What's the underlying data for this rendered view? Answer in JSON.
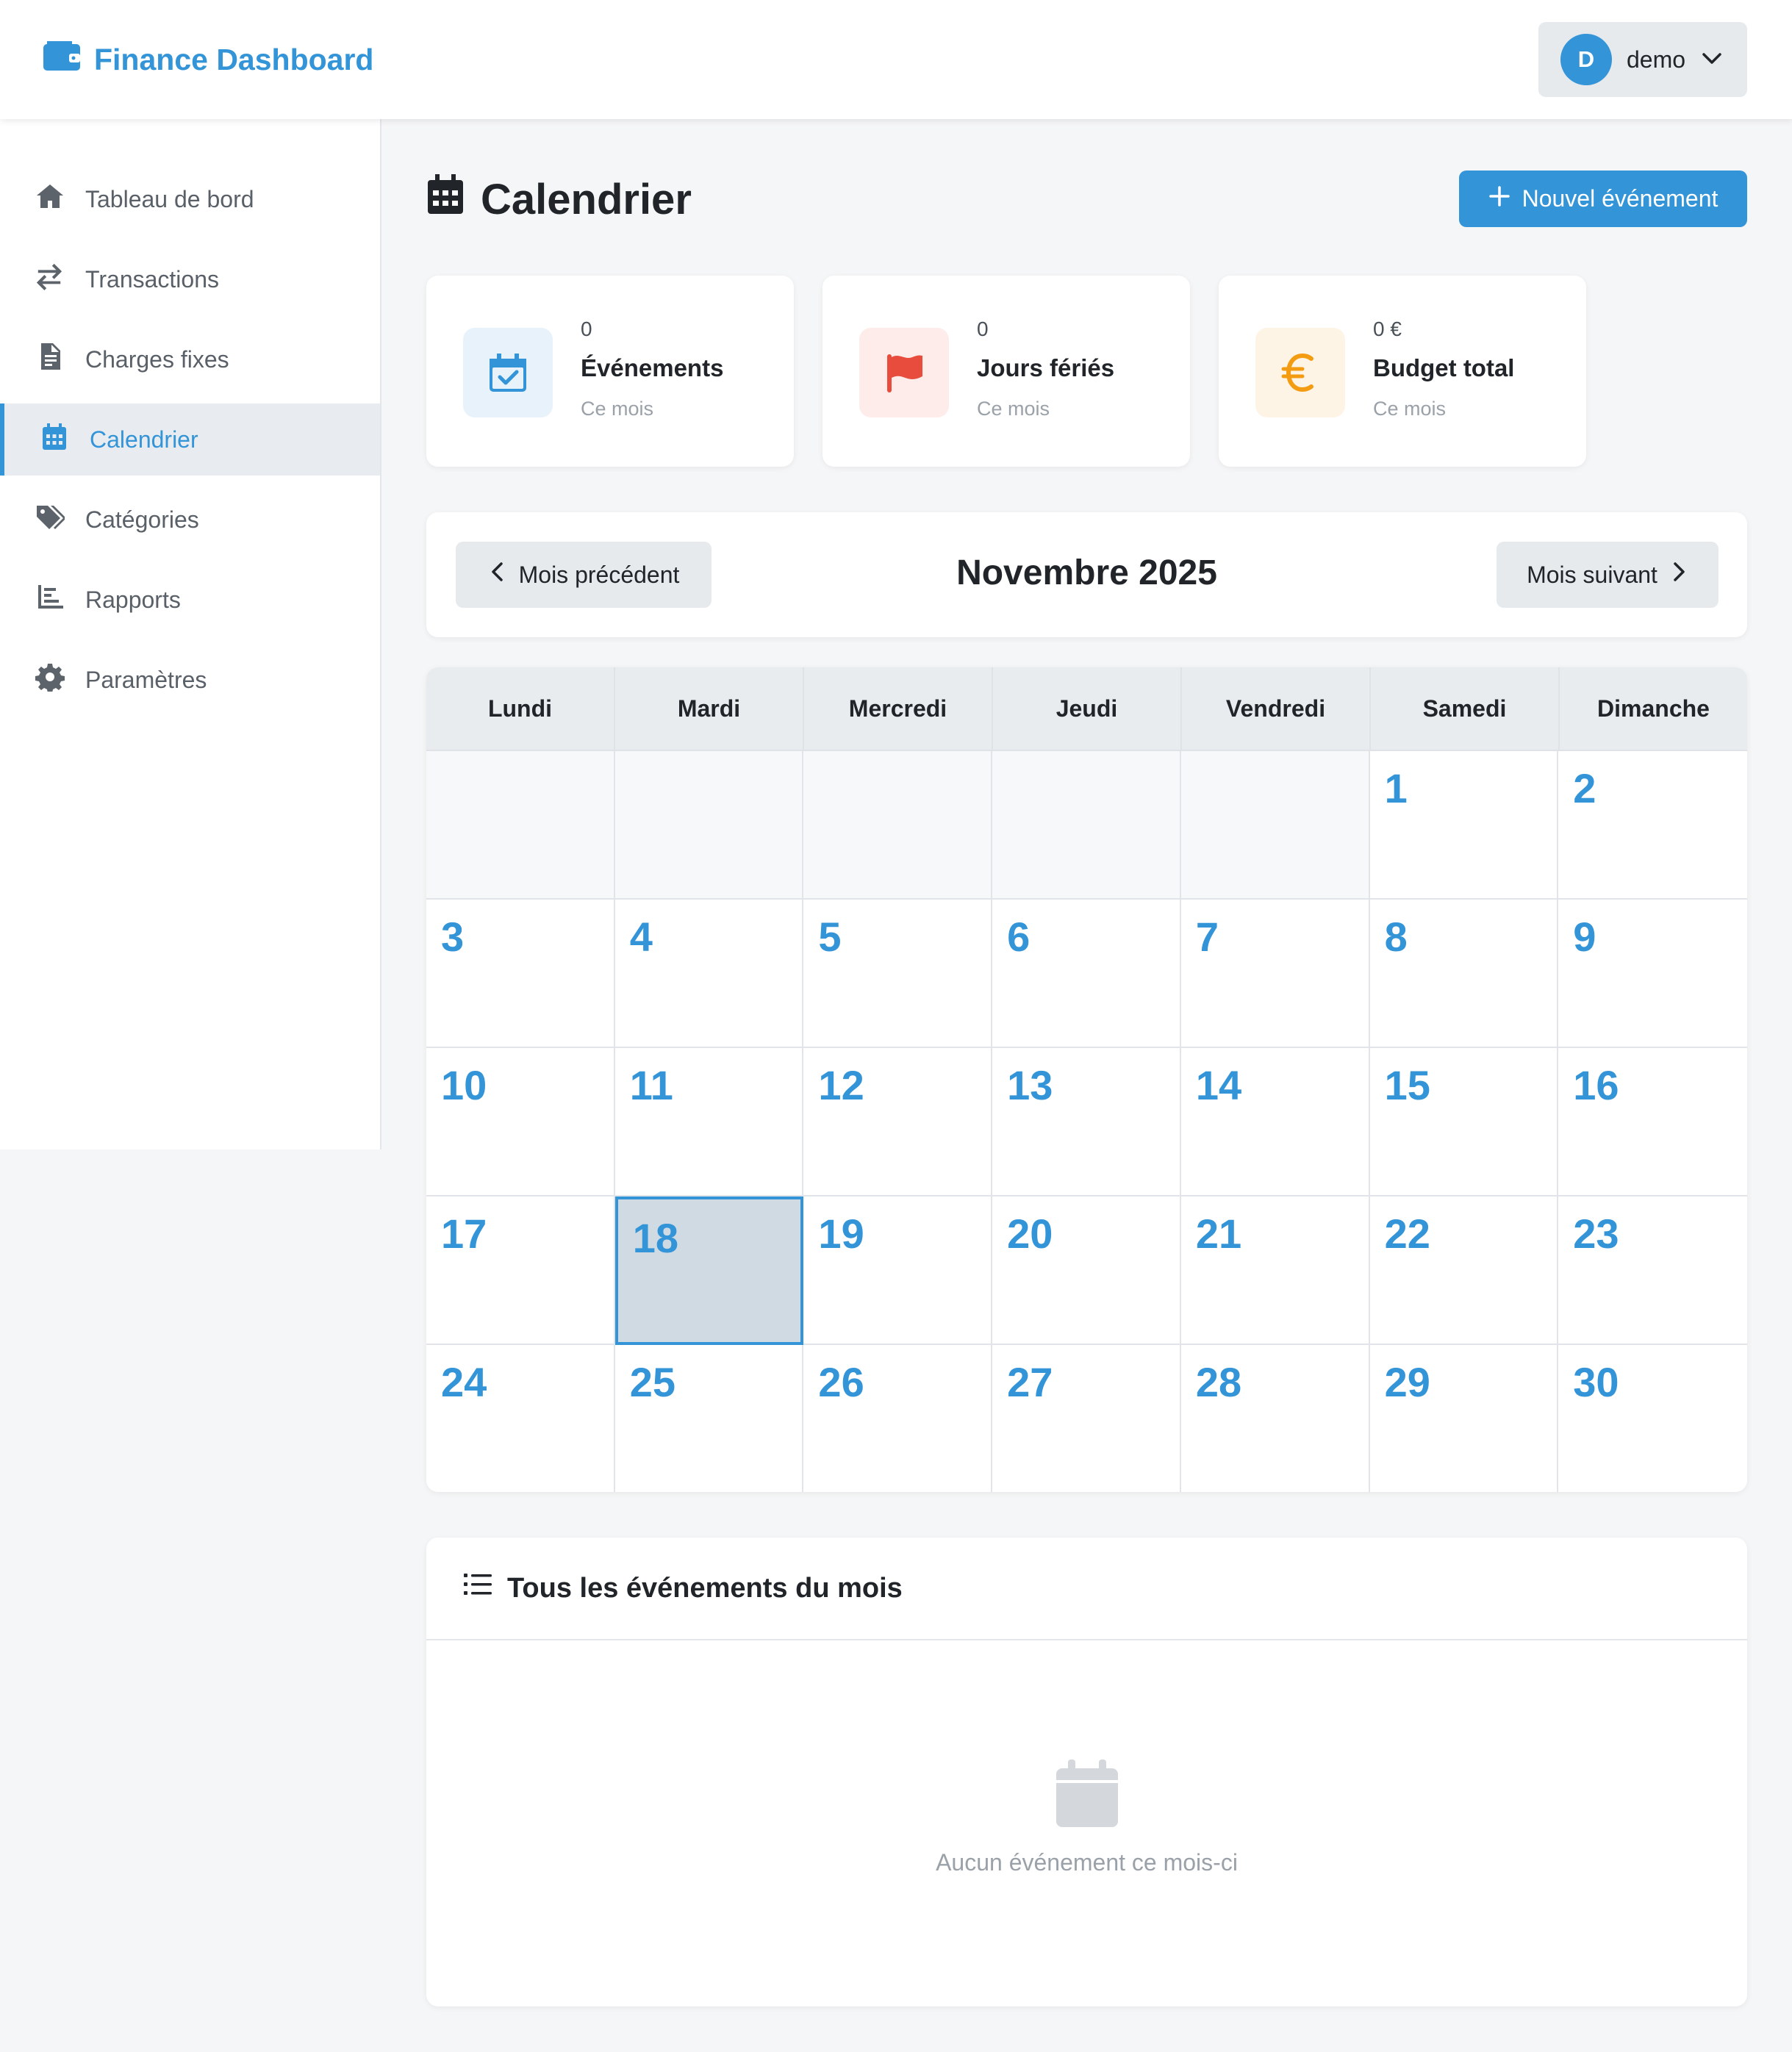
{
  "app": {
    "brand": "Finance Dashboard",
    "user": {
      "initial": "D",
      "name": "demo"
    }
  },
  "sidebar": {
    "items": [
      {
        "label": "Tableau de bord",
        "icon": "home-icon",
        "active": false
      },
      {
        "label": "Transactions",
        "icon": "exchange-icon",
        "active": false
      },
      {
        "label": "Charges fixes",
        "icon": "invoice-icon",
        "active": false
      },
      {
        "label": "Calendrier",
        "icon": "calendar-icon",
        "active": true
      },
      {
        "label": "Catégories",
        "icon": "tags-icon",
        "active": false
      },
      {
        "label": "Rapports",
        "icon": "chart-icon",
        "active": false
      },
      {
        "label": "Paramètres",
        "icon": "gear-icon",
        "active": false
      }
    ]
  },
  "header": {
    "title": "Calendrier",
    "new_event_label": "Nouvel événement"
  },
  "stats": [
    {
      "value": "0",
      "label": "Événements",
      "sub": "Ce mois",
      "icon": "calendar-check-icon",
      "color": "#3394d8",
      "bg": "#e8f2fb"
    },
    {
      "value": "0",
      "label": "Jours fériés",
      "sub": "Ce mois",
      "icon": "flag-icon",
      "color": "#e74c3c",
      "bg": "#fdecea"
    },
    {
      "value": "0 €",
      "label": "Budget total",
      "sub": "Ce mois",
      "icon": "euro-icon",
      "color": "#f39c12",
      "bg": "#fef4e6"
    }
  ],
  "month_nav": {
    "prev_label": "Mois précédent",
    "title": "Novembre 2025",
    "next_label": "Mois suivant"
  },
  "calendar": {
    "weekdays": [
      "Lundi",
      "Mardi",
      "Mercredi",
      "Jeudi",
      "Vendredi",
      "Samedi",
      "Dimanche"
    ],
    "weeks": [
      [
        "",
        "",
        "",
        "",
        "",
        "1",
        "2"
      ],
      [
        "3",
        "4",
        "5",
        "6",
        "7",
        "8",
        "9"
      ],
      [
        "10",
        "11",
        "12",
        "13",
        "14",
        "15",
        "16"
      ],
      [
        "17",
        "18",
        "19",
        "20",
        "21",
        "22",
        "23"
      ],
      [
        "24",
        "25",
        "26",
        "27",
        "28",
        "29",
        "30"
      ]
    ],
    "today": "18"
  },
  "events": {
    "title": "Tous les événements du mois",
    "empty_text": "Aucun événement ce mois-ci"
  },
  "colors": {
    "accent": "#3394d8",
    "background": "#f5f6f7"
  }
}
